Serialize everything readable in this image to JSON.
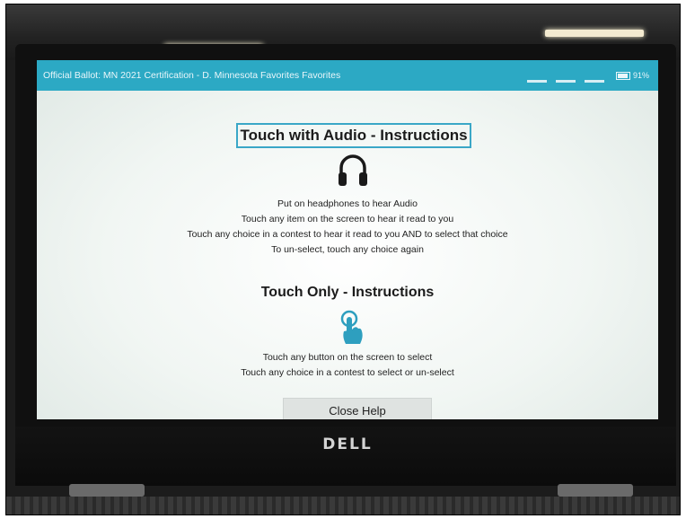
{
  "title_bar": {
    "title": "Official Ballot: MN 2021 Certification - D. Minnesota Favorites Favorites",
    "battery": "91%"
  },
  "audio_section": {
    "heading": "Touch with Audio - Instructions",
    "icon": "headphones-icon",
    "lines": [
      "Put on headphones to hear Audio",
      "Touch any item on the screen to hear it read to you",
      "Touch any choice in a contest to hear it read to you AND to select that choice",
      "To un-select, touch any choice again"
    ]
  },
  "touch_section": {
    "heading": "Touch Only - Instructions",
    "icon": "touch-hand-icon",
    "lines": [
      "Touch any button on the screen to select",
      "Touch any choice in a contest to select or un-select"
    ]
  },
  "close_button": {
    "label": "Close Help"
  },
  "device": {
    "brand": "DELL"
  },
  "colors": {
    "title_bar": "#2ca9c4",
    "accent": "#3aa7c7"
  }
}
